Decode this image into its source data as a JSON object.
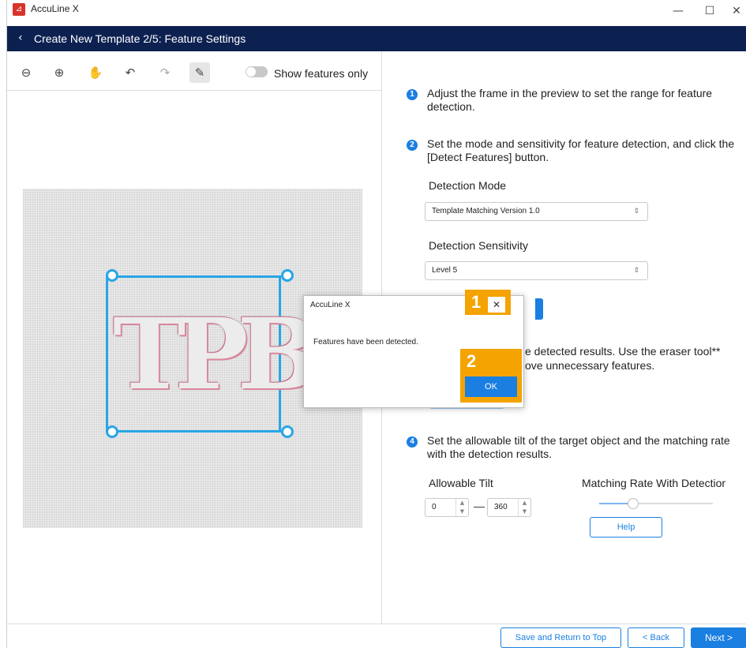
{
  "window": {
    "app_title": "AccuLine X",
    "logo_glyph": "⊿",
    "minimize": "—",
    "maximize": "☐",
    "close": "✕"
  },
  "nav": {
    "back": "‹",
    "title": "Create New Template 2/5: Feature Settings"
  },
  "toolbar": {
    "zoom_out": "⊖",
    "zoom_in": "⊕",
    "pan": "✋",
    "undo": "↶",
    "redo": "↷",
    "eraser": "✎",
    "show_features_label": "Show features only",
    "show_features_on": false
  },
  "preview": {
    "logo_text": "TPB"
  },
  "steps": {
    "s1": {
      "num": "1",
      "text": "Adjust the frame in the preview to set the range for feature detection."
    },
    "s2": {
      "num": "2",
      "text": "Set the mode and sensitivity for feature detection, and click the [Detect Features] button."
    },
    "s3": {
      "text_line1": "e detected results. Use the eraser tool**",
      "text_line2": "ove unnecessary features."
    },
    "s4": {
      "num": "4",
      "text": "Set the allowable tilt of the target object and the matching rate with the detection results."
    }
  },
  "detection_mode": {
    "label": "Detection Mode",
    "value": "Template Matching Version 1.0",
    "arrow": "⇕"
  },
  "detection_sensitivity": {
    "label": "Detection Sensitivity",
    "value": "Level 5",
    "arrow": "⇕"
  },
  "tilt": {
    "label": "Allowable Tilt",
    "min": "0",
    "max": "360",
    "dash": "—",
    "spin_up": "▲",
    "spin_down": "▼"
  },
  "matching_rate": {
    "label": "Matching Rate With Detectior",
    "level": 0.3
  },
  "help_button": "Help",
  "bottom": {
    "save_return": "Save and Return to Top",
    "back": "< Back",
    "next": "Next >"
  },
  "dialog": {
    "title": "AccuLine X",
    "message": "Features have been detected.",
    "close": "✕",
    "ok": "OK"
  },
  "callouts": {
    "c1": "1",
    "c2": "2"
  },
  "colors": {
    "accent": "#1a7fe0",
    "navbar": "#0d2151",
    "callout": "#f4a300",
    "frame": "#28a6e6"
  }
}
